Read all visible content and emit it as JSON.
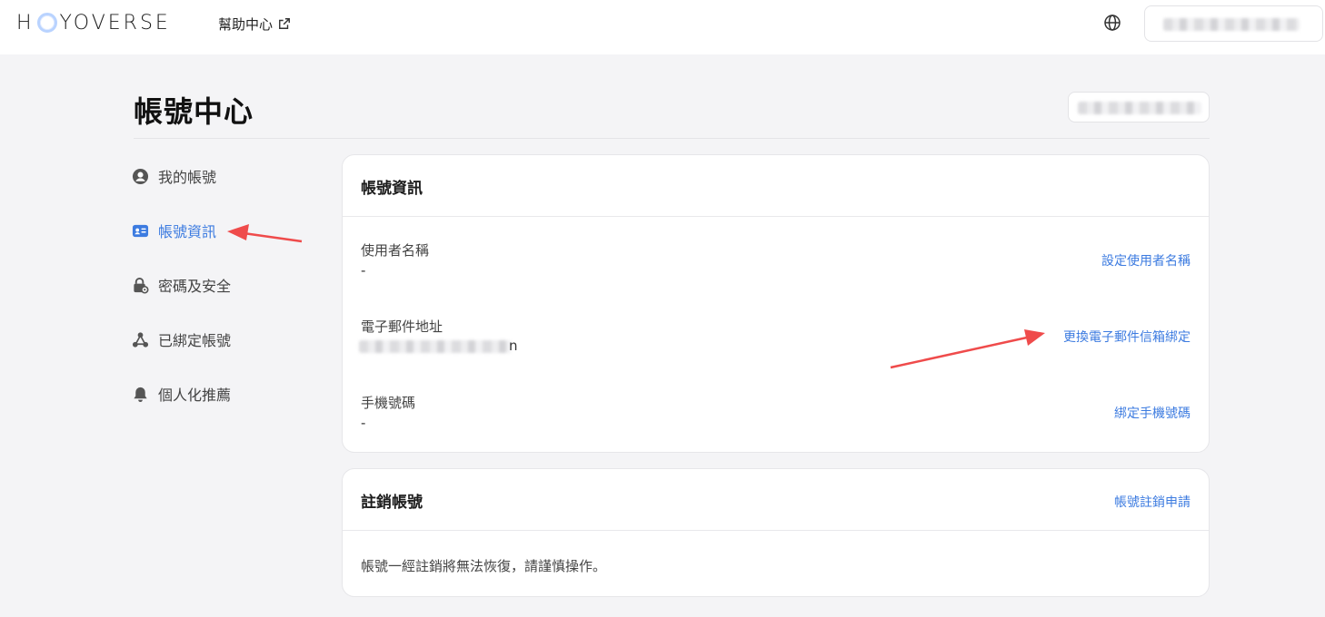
{
  "header": {
    "logo_text_left": "H",
    "logo_text_right": "YOVERSE",
    "help_center_label": "幫助中心",
    "icons": {
      "external": "external-link-icon",
      "language": "globe-icon"
    }
  },
  "page": {
    "title": "帳號中心"
  },
  "sidebar": {
    "items": [
      {
        "label": "我的帳號",
        "icon": "user-circle-icon",
        "active": false
      },
      {
        "label": "帳號資訊",
        "icon": "id-card-icon",
        "active": true
      },
      {
        "label": "密碼及安全",
        "icon": "lock-key-icon",
        "active": false
      },
      {
        "label": "已綁定帳號",
        "icon": "linked-nodes-icon",
        "active": false
      },
      {
        "label": "個人化推薦",
        "icon": "bell-icon",
        "active": false
      }
    ]
  },
  "account_info": {
    "title": "帳號資訊",
    "fields": [
      {
        "label": "使用者名稱",
        "value": "-",
        "action": "設定使用者名稱"
      },
      {
        "label": "電子郵件地址",
        "value_visible_suffix": "n",
        "action": "更換電子郵件信箱綁定"
      },
      {
        "label": "手機號碼",
        "value": "-",
        "action": "綁定手機號碼"
      }
    ]
  },
  "delete_account": {
    "title": "註銷帳號",
    "action": "帳號註銷申請",
    "note": "帳號一經註銷將無法恢復，請謹慎操作。"
  },
  "colors": {
    "accent": "#3c7be0",
    "background": "#f4f4f6",
    "annotation_arrow": "#ef4b4b"
  }
}
